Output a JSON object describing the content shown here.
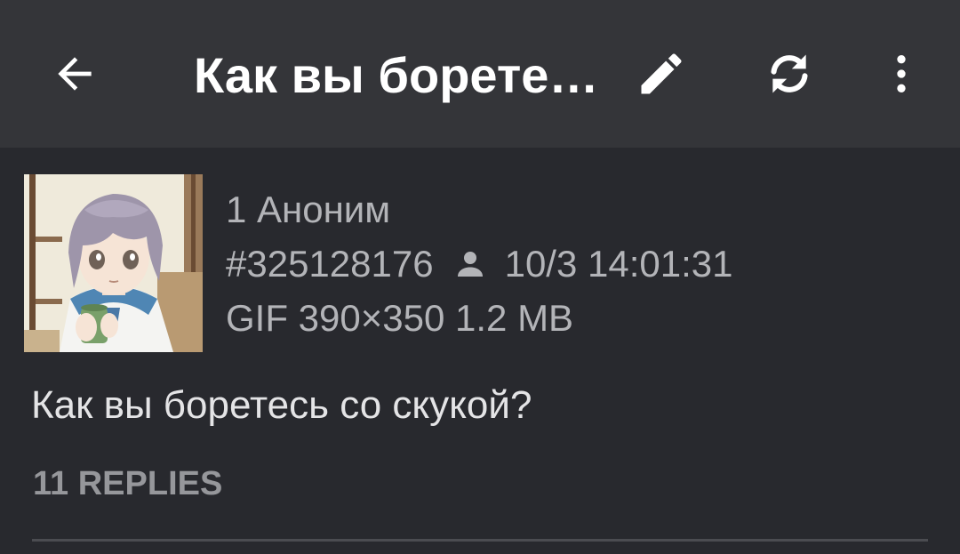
{
  "toolbar": {
    "title": "Как вы борете…",
    "back_icon": "arrow-back-icon",
    "edit_icon": "pencil-icon",
    "refresh_icon": "refresh-icon",
    "more_icon": "more-vert-icon"
  },
  "post": {
    "index": "1",
    "name": "Аноним",
    "number": "#325128176",
    "poster_icon": "person-icon",
    "date": "10/3 14:01:31",
    "file_info": "GIF 390×350 1.2 MB",
    "text": "Как вы боретесь со скукой?",
    "replies": "11 REPLIES"
  },
  "colors": {
    "toolbar_bg": "#343539",
    "background": "#28292e",
    "primary_text": "#ffffff",
    "secondary_text": "#b3b4b8"
  }
}
